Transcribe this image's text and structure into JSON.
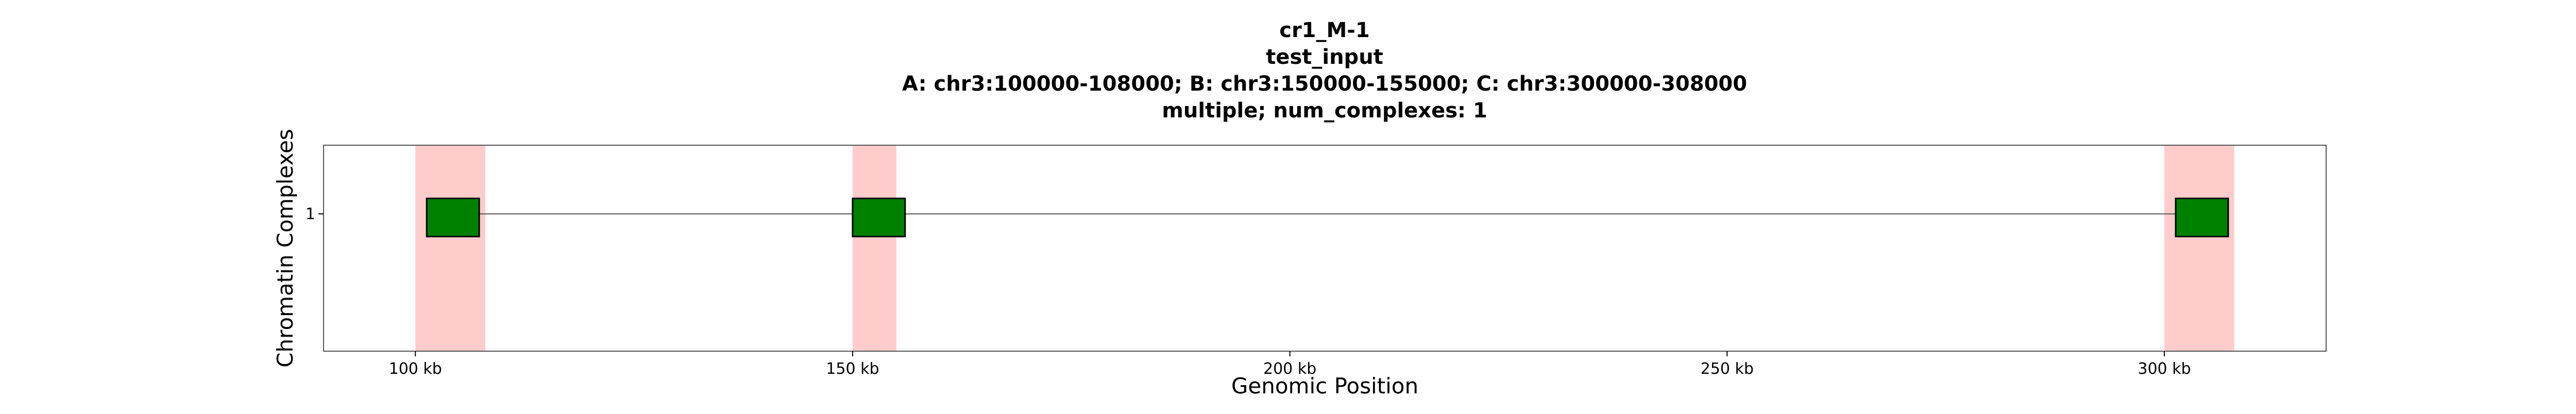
{
  "chart_data": {
    "type": "scatter",
    "title_lines": [
      "cr1_M-1",
      "test_input",
      "A: chr3:100000-108000; B: chr3:150000-155000; C: chr3:300000-308000",
      "multiple; num_complexes: 1"
    ],
    "xlabel": "Genomic Position",
    "ylabel": "Chromatin Complexes",
    "xlim": [
      89500,
      318500
    ],
    "x_ticks": [
      100000,
      150000,
      200000,
      250000,
      300000
    ],
    "x_tick_labels": [
      "100 kb",
      "150 kb",
      "200 kb",
      "250 kb",
      "300 kb"
    ],
    "ylim": [
      0,
      1.5
    ],
    "y_ticks": [
      1
    ],
    "y_tick_labels": [
      "1"
    ],
    "anchor_regions": [
      {
        "label": "A",
        "chrom": "chr3",
        "start": 100000,
        "end": 108000
      },
      {
        "label": "B",
        "chrom": "chr3",
        "start": 150000,
        "end": 155000
      },
      {
        "label": "C",
        "chrom": "chr3",
        "start": 300000,
        "end": 308000
      }
    ],
    "complexes": [
      {
        "y": 1,
        "fragments": [
          {
            "start": 101300,
            "end": 107300
          },
          {
            "start": 150000,
            "end": 156000
          },
          {
            "start": 301300,
            "end": 307300
          }
        ]
      }
    ],
    "colors": {
      "region_fill": "#ffcccc",
      "fragment_fill": "#008000",
      "fragment_edge": "#000000",
      "link_line": "#555555",
      "axis": "#555555"
    },
    "grid": false,
    "legend": "none"
  }
}
